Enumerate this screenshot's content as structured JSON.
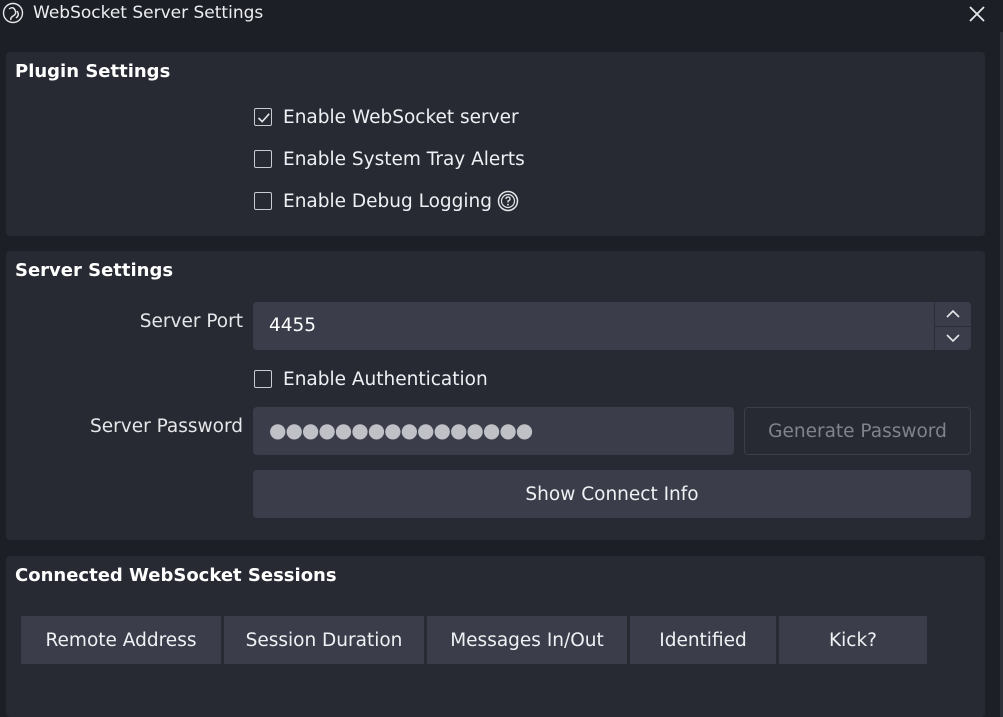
{
  "window": {
    "title": "WebSocket Server Settings",
    "app_icon": "obs-icon",
    "close_icon": "close-icon"
  },
  "plugin_settings": {
    "title": "Plugin Settings",
    "options": [
      {
        "label": "Enable WebSocket server",
        "checked": true
      },
      {
        "label": "Enable System Tray Alerts",
        "checked": false
      },
      {
        "label": "Enable Debug Logging",
        "checked": false
      }
    ],
    "debug_help_icon": "help-icon"
  },
  "server_settings": {
    "title": "Server Settings",
    "port_label": "Server Port",
    "port_value": "4455",
    "auth_label": "Enable Authentication",
    "auth_checked": false,
    "password_label": "Server Password",
    "password_value": "●●●●●●●●●●●●●●●●",
    "generate_label": "Generate Password",
    "connect_info_label": "Show Connect Info"
  },
  "sessions": {
    "title": "Connected WebSocket Sessions",
    "columns": [
      "Remote Address",
      "Session Duration",
      "Messages In/Out",
      "Identified",
      "Kick?"
    ]
  },
  "colors": {
    "background": "#1d1f26",
    "group": "#272a33",
    "input": "#3b3e4a",
    "text": "#e6e7ea"
  }
}
